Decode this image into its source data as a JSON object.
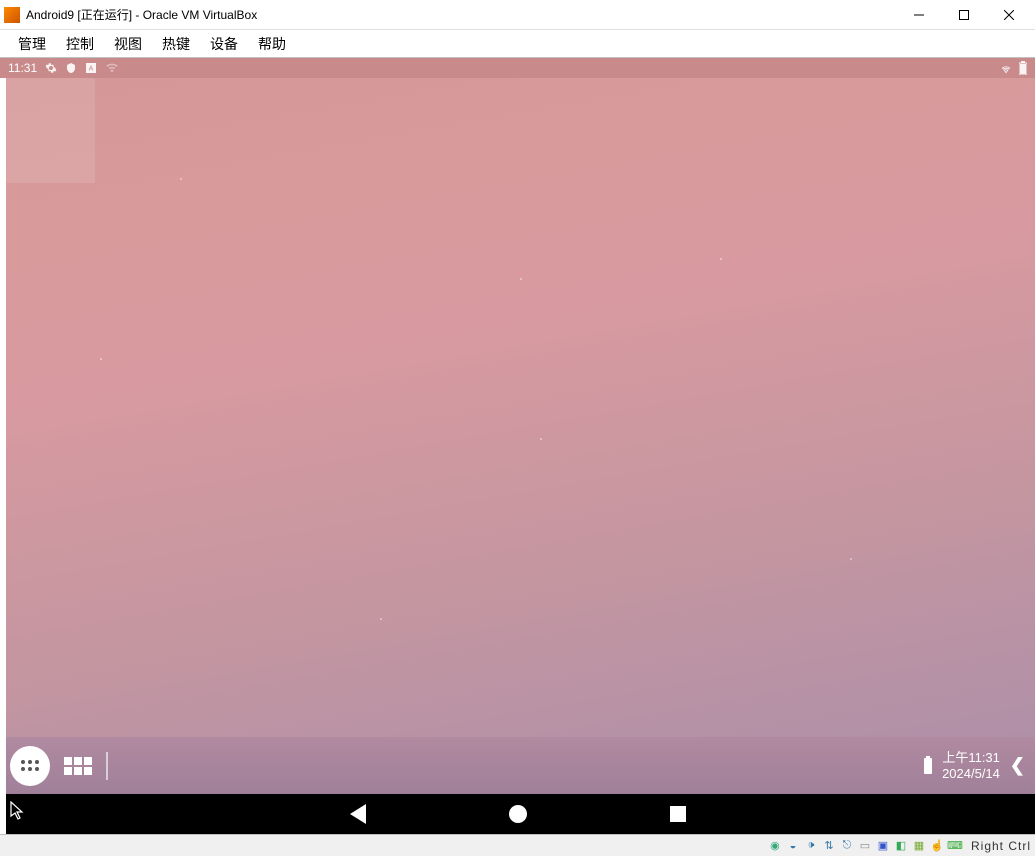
{
  "window": {
    "title": "Android9 [正在运行] - Oracle VM VirtualBox"
  },
  "menubar": {
    "items": [
      "管理",
      "控制",
      "视图",
      "热键",
      "设备",
      "帮助"
    ]
  },
  "android": {
    "statusbar": {
      "time": "11:31"
    },
    "dock": {
      "time": "上午11:31",
      "date": "2024/5/14"
    }
  },
  "vb_status": {
    "hostkey": "Right Ctrl"
  }
}
